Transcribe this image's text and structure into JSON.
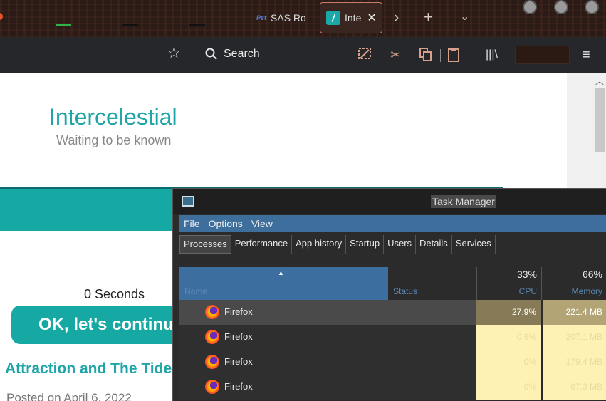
{
  "browser": {
    "tabs": [
      {
        "label": "SAS Ro",
        "favicon": "Pst"
      },
      {
        "label": "Inte",
        "favicon": "/"
      }
    ],
    "search_label": "Search"
  },
  "page": {
    "site_title": "Intercelestial",
    "tagline": "Waiting to be known",
    "countdown": "0 Seconds",
    "continue_button": "OK, let's continue",
    "article_title": "Attraction and The Tide",
    "posted": "Posted on April 6, 2022"
  },
  "task_manager": {
    "title": "Task Manager",
    "menu": [
      "File",
      "Options",
      "View"
    ],
    "tabs": [
      "Processes",
      "Performance",
      "App history",
      "Startup",
      "Users",
      "Details",
      "Services"
    ],
    "columns": {
      "name": "Name",
      "status": "Status",
      "cpu": {
        "label": "CPU",
        "percent": "33%"
      },
      "memory": {
        "label": "Memory",
        "percent": "66%"
      }
    },
    "rows": [
      {
        "name": "Firefox",
        "cpu": "27.9%",
        "memory": "221.4 MB"
      },
      {
        "name": "Firefox",
        "cpu": "0.6%",
        "memory": "207.1 MB"
      },
      {
        "name": "Firefox",
        "cpu": "0%",
        "memory": "179.4 MB"
      },
      {
        "name": "Firefox",
        "cpu": "0%",
        "memory": "67.3 MB"
      }
    ]
  },
  "colors": {
    "accent_teal": "#16a9a4",
    "tm_blue": "#3d6e9c",
    "row_selected": "#4a4a4a",
    "cpu_selected": "#877a57",
    "mem_selected": "#b3a476",
    "cpu_light": "#fdf1b4",
    "mem_light": "#fdf1b4"
  }
}
